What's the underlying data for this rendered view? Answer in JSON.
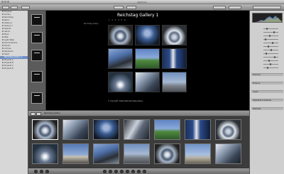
{
  "window": {
    "title": "Aperture"
  },
  "library": {
    "items": [
      "Projects",
      "Library",
      "Reichstag",
      "Berlin",
      "Gallery 1",
      "Gallery 2",
      "Selects",
      "Album",
      "Book",
      "Web",
      "Light Table",
      "Smart Albums",
      "Export",
      "Archive",
      "Keywords",
      "Vault",
      "Reichstag Gallery 1",
      "Projects A",
      "Projects B",
      "Projects C",
      "Projects D"
    ],
    "selected_index": 16
  },
  "viewer": {
    "gallery_title": "Reichstag Gallery 1",
    "page_dots": "1 2 3 4 5 6",
    "side_label": "Reichstag Gallery",
    "copyright": "© Copyright. Dallas Web Reichstag Gallery"
  },
  "browser": {
    "tab_label": "Reichstag Gallery"
  },
  "inspector": {
    "sections": [
      "Exposure",
      "Enhance",
      "Levels",
      "Highlights & Shadows",
      "Metadata"
    ]
  },
  "colors": {
    "selection": "#6e8fc7",
    "viewer_bg": "#000000",
    "browser_bg": "#3c3c3c"
  }
}
